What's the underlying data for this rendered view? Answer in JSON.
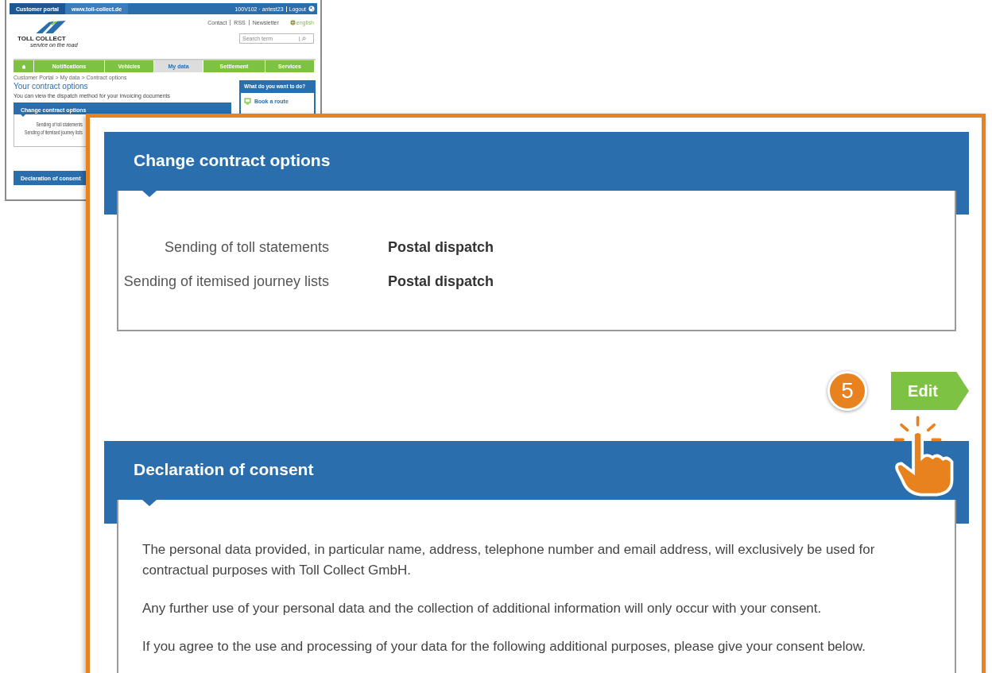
{
  "thumbnail": {
    "top_tabs": [
      {
        "label": "Customer portal",
        "selected": true
      },
      {
        "label": "www.toll-collect.de",
        "selected": false
      }
    ],
    "user": "100V102 · antest23",
    "logout": "Logout",
    "logo": {
      "name": "TOLL COLLECT",
      "tagline": "service on the road"
    },
    "header_links": [
      "Contact",
      "RSS",
      "Newsletter"
    ],
    "language": "english",
    "search": {
      "placeholder": "Search term"
    },
    "nav": [
      {
        "kind": "home",
        "selected": false
      },
      {
        "kind": "text",
        "label": "Notifications",
        "selected": false
      },
      {
        "kind": "text",
        "label": "Vehicles",
        "selected": false
      },
      {
        "kind": "text",
        "label": "My data",
        "selected": true
      },
      {
        "kind": "text",
        "label": "Settlement",
        "selected": false
      },
      {
        "kind": "text",
        "label": "Services",
        "selected": false
      }
    ],
    "breadcrumb": "Customer Portal > My data > Contract options",
    "title": "Your contract options",
    "intro": "You can view the dispatch method for your invoicing documents",
    "contract_box": {
      "title": "Change contract options",
      "rows": [
        "Sending of toll statements",
        "Sending of itemised journey lists"
      ]
    },
    "consent_title": "Declaration of consent",
    "sidebar": {
      "title": "What do you want to do?",
      "items": [
        "Book a route"
      ]
    }
  },
  "zoom": {
    "contract_box": {
      "title": "Change contract options",
      "rows": [
        {
          "label": "Sending of toll statements",
          "value": "Postal dispatch"
        },
        {
          "label": "Sending of itemised journey lists",
          "value": "Postal dispatch"
        }
      ]
    },
    "step_badge": "5",
    "edit_button": "Edit",
    "consent": {
      "title": "Declaration of consent",
      "paragraphs": [
        "The personal data provided, in particular name, address, telephone number and email address, will exclusively be used for contractual purposes with Toll Collect GmbH.",
        "Any further use of your personal data and the collection of additional information will only occur with your consent.",
        "If you agree to the use and processing of your data for the following additional purposes, please give your consent below."
      ]
    }
  }
}
